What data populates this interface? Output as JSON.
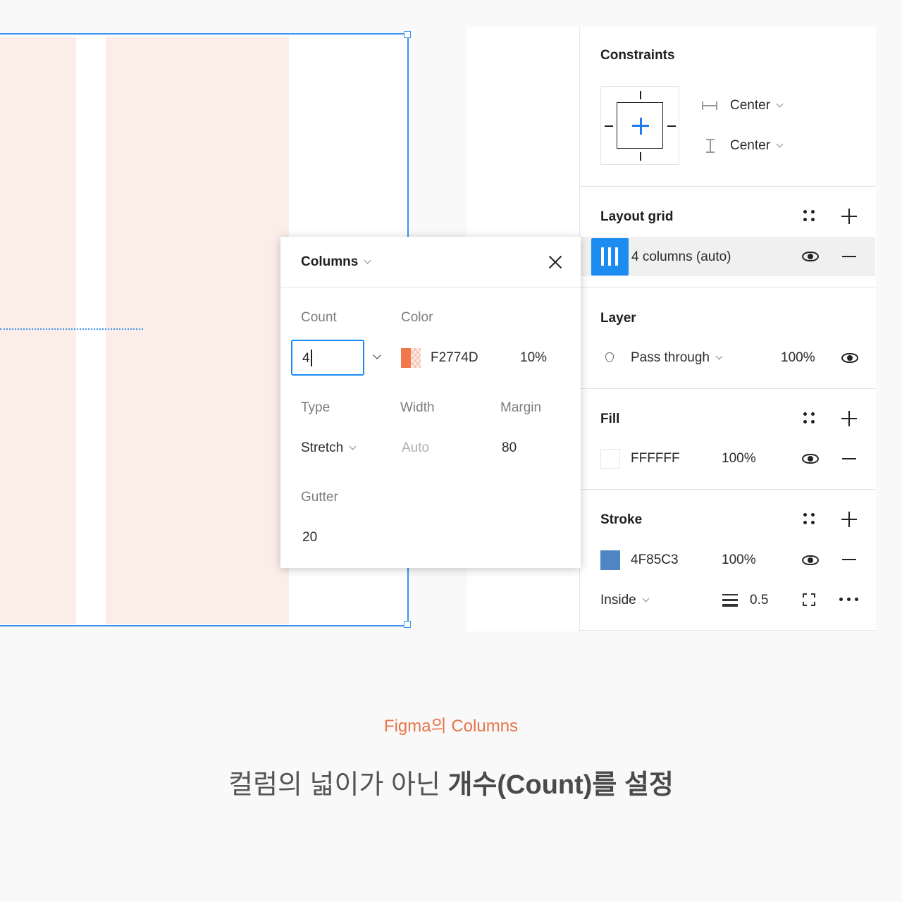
{
  "colors": {
    "accent": "#3b93f1",
    "grid_column": "#F2774D",
    "stroke": "#4F85C3",
    "caption_accent": "#e8754a"
  },
  "constraints": {
    "title": "Constraints",
    "horizontal": "Center",
    "vertical": "Center"
  },
  "layout_grid": {
    "title": "Layout grid",
    "item_label": "4 columns (auto)"
  },
  "layer": {
    "title": "Layer",
    "blend_mode": "Pass through",
    "opacity": "100%"
  },
  "fill": {
    "title": "Fill",
    "hex": "FFFFFF",
    "opacity": "100%"
  },
  "stroke": {
    "title": "Stroke",
    "hex": "4F85C3",
    "opacity": "100%",
    "position": "Inside",
    "weight": "0.5"
  },
  "popup": {
    "title": "Columns",
    "count_label": "Count",
    "count_value": "4",
    "color_label": "Color",
    "color_hex": "F2774D",
    "color_opacity": "10%",
    "type_label": "Type",
    "type_value": "Stretch",
    "width_label": "Width",
    "width_value": "Auto",
    "margin_label": "Margin",
    "margin_value": "80",
    "gutter_label": "Gutter",
    "gutter_value": "20"
  },
  "caption": {
    "subtitle": "Figma의 Columns",
    "main_regular": "컬럼의 넓이가 아닌 ",
    "main_bold": "개수(Count)를 설정"
  }
}
